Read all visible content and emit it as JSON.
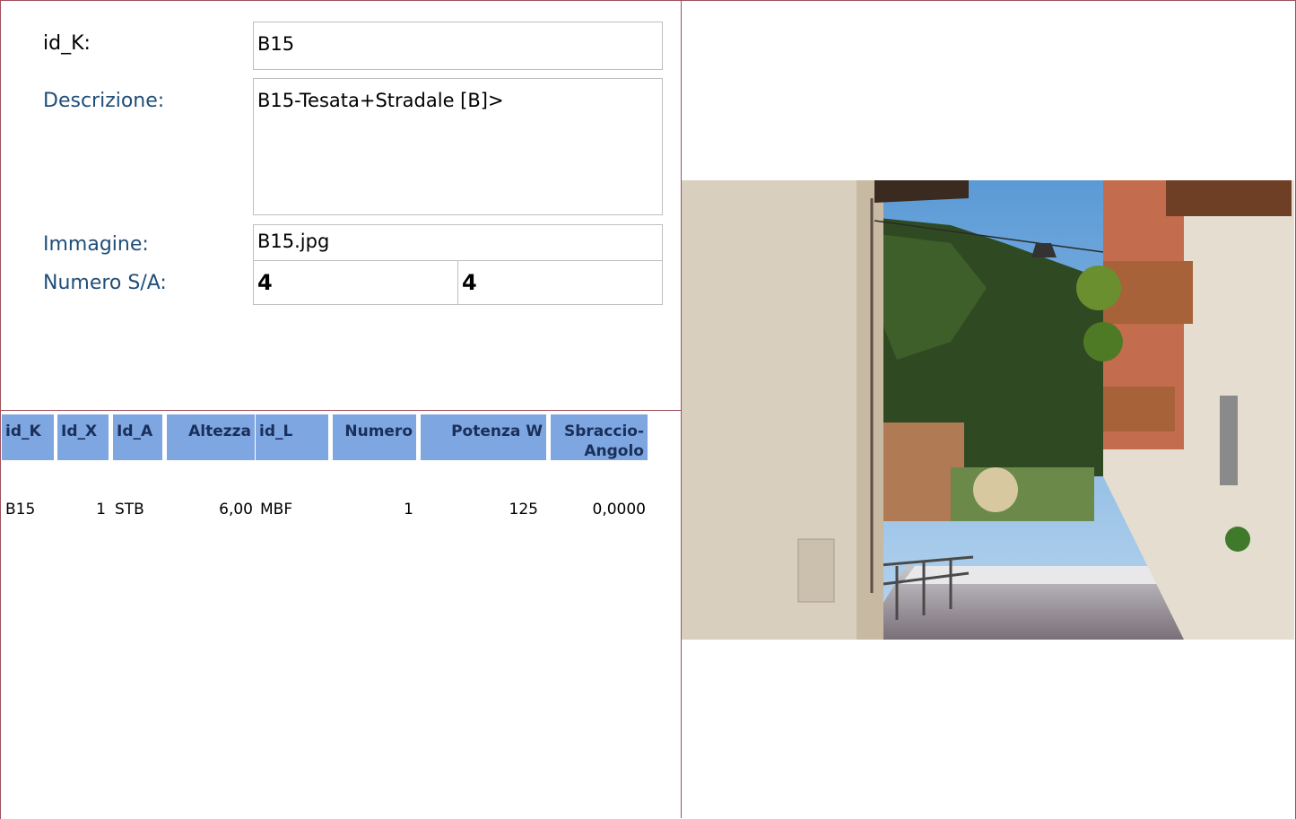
{
  "form": {
    "idk_label": "id_K:",
    "idk_value": "B15",
    "descrizione_label": "Descrizione:",
    "descrizione_value": "B15-Tesata+Stradale [B]>",
    "immagine_label": "Immagine:",
    "immagine_value": "B15.jpg",
    "numero_label": "Numero S/A:",
    "numero_s": "4",
    "numero_a": "4"
  },
  "table": {
    "headers": [
      "id_K",
      "Id_X",
      "Id_A",
      "Altezza",
      "id_L",
      "Numero",
      "Potenza W",
      "Sbraccio-",
      "Angolo"
    ],
    "row": [
      "B15",
      "1",
      "STB",
      "6,00",
      "MBF",
      "1",
      "125",
      "0,0000"
    ]
  },
  "photo": {
    "subject": "street-lamp-photo"
  }
}
